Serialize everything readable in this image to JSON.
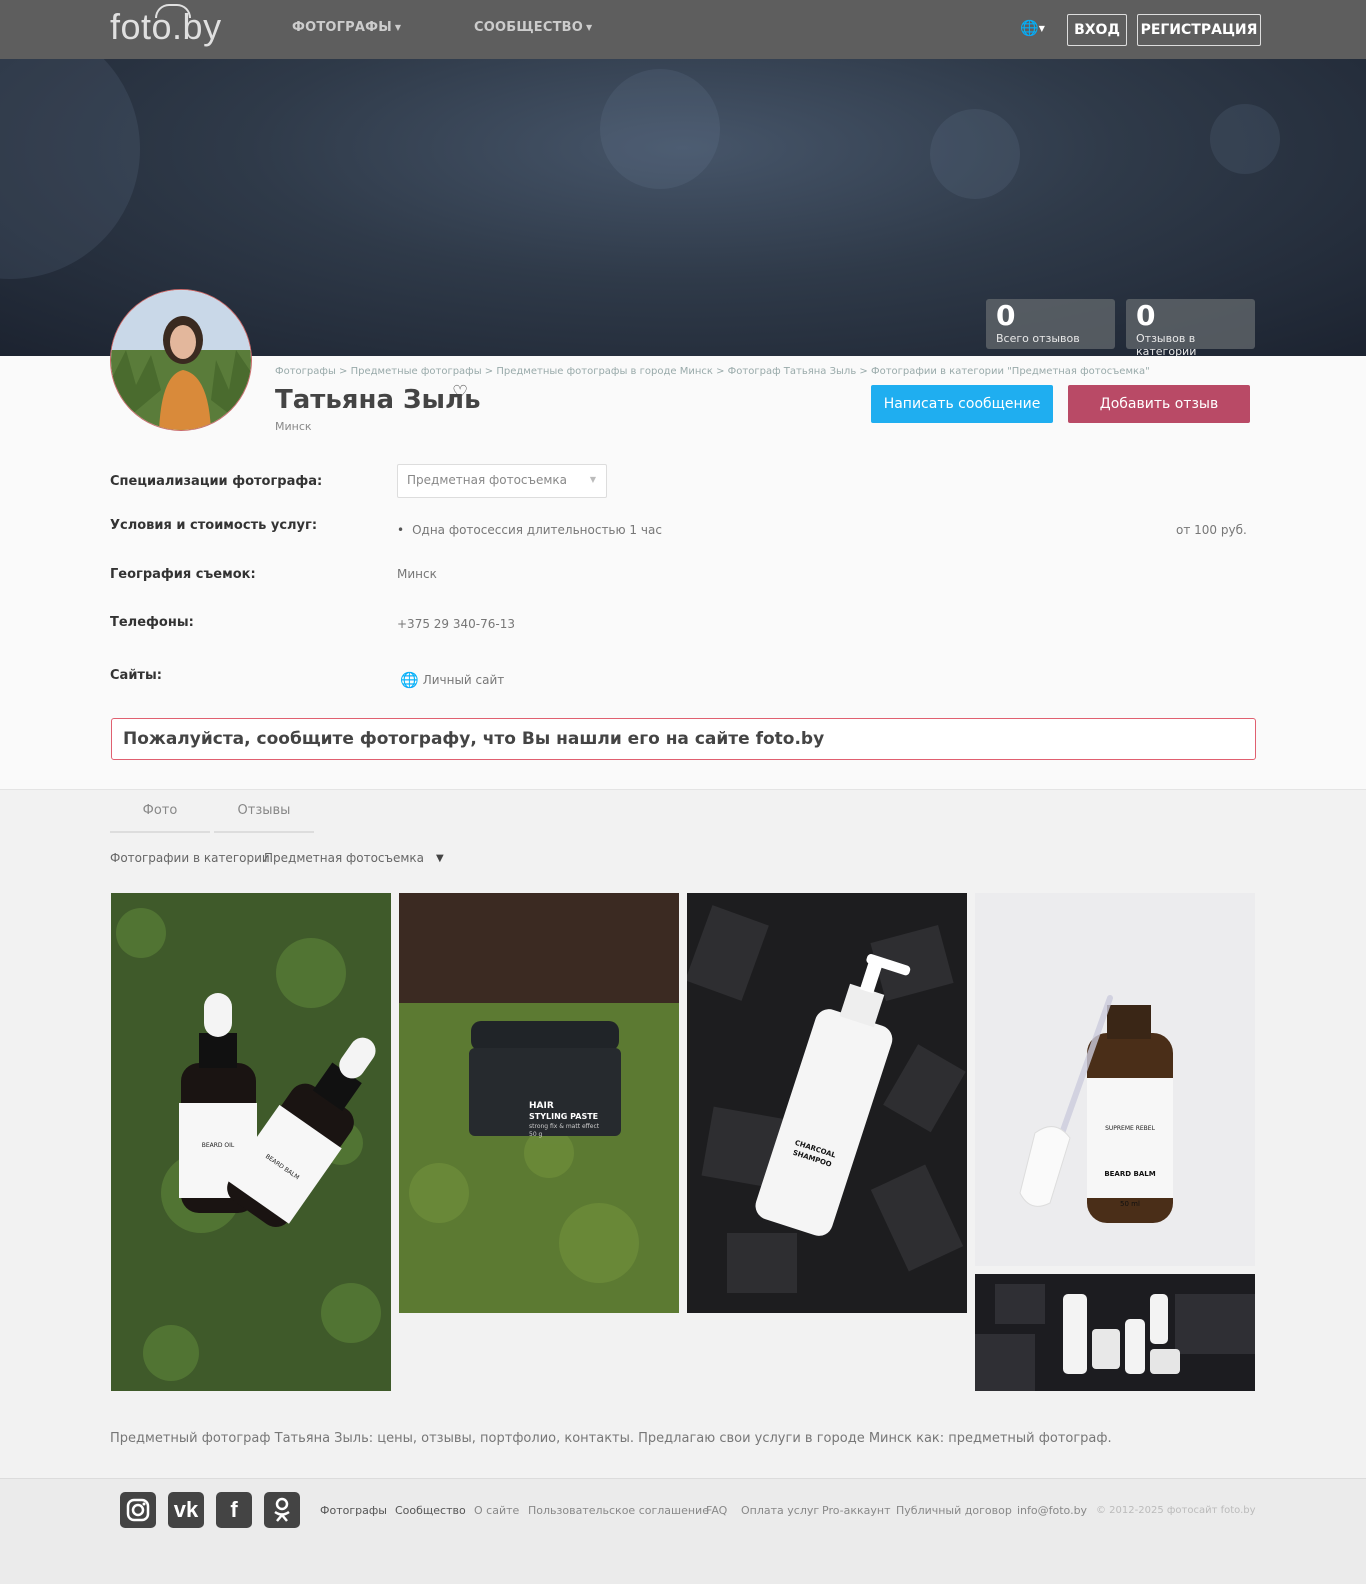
{
  "nav": {
    "logo": "foto.by",
    "photographers": "ФОТОГРАФЫ",
    "community": "СООБЩЕСТВО",
    "login": "ВХОД",
    "register": "РЕГИСТРАЦИЯ"
  },
  "stats": [
    {
      "num": "0",
      "label": "Всего отзывов"
    },
    {
      "num": "0",
      "label": "Отзывов в категории"
    }
  ],
  "breadcrumb": [
    "Фотографы",
    "Предметные фотографы",
    "Предметные фотографы в городе Минск",
    "Фотограф Татьяна Зыль",
    "Фотографии в категории \"Предметная фотосъемка\""
  ],
  "profile": {
    "name": "Татьяна Зыль",
    "city": "Минск",
    "write_message": "Написать сообщение",
    "add_review": "Добавить отзыв"
  },
  "details": {
    "spec_label": "Специализации фотографа:",
    "spec_value": "Предметная фотосъемка",
    "terms_label": "Условия и стоимость услуг:",
    "terms_item": "Одна фотосессия длительностью 1 час",
    "terms_price": "от 100 руб.",
    "geo_label": "География съемок:",
    "geo_value": "Минск",
    "phones_label": "Телефоны:",
    "phones_value": "+375 29 340-76-13",
    "sites_label": "Сайты:",
    "sites_value": "Личный сайт"
  },
  "notice": "Пожалуйста, сообщите фотографу, что Вы нашли его на сайте foto.by",
  "tabs": [
    "Фото",
    "Отзывы"
  ],
  "filter": {
    "label": "Фотографии в категории",
    "value": "Предметная фотосъемка"
  },
  "photos": {
    "p1": {
      "title": "BEARD OIL",
      "sub": "BEARD BALM"
    },
    "p2": {
      "line1": "HAIR",
      "line2": "STYLING PASTE",
      "line3": "strong fix & matt effect",
      "line4": "50 g"
    },
    "p3": {
      "line1": "CHARCOAL",
      "line2": "SHAMPOO"
    },
    "p4": {
      "line1": "SUPREME REBEL",
      "line2": "BEARD BALM",
      "line3": "50 ml"
    }
  },
  "description": "Предметный фотограф Татьяна Зыль: цены, отзывы, портфолио, контакты. Предлагаю свои услуги в городе Минск как: предметный фотограф.",
  "footer": {
    "links": [
      "Фотографы",
      "Сообщество",
      "О сайте",
      "Пользовательское соглашение",
      "FAQ",
      "Оплата услуг",
      "Pro-аккаунт",
      "Публичный договор",
      "info@foto.by"
    ],
    "copyright": "© 2012-2025 фотосайт foto.by"
  },
  "icons": {
    "instagram": "instagram-icon",
    "vk": "vk-icon",
    "facebook": "facebook-icon",
    "ok": "odnoklassniki-icon",
    "globe": "globe-icon",
    "heart": "heart-icon"
  },
  "colors": {
    "accent_blue": "#1faef0",
    "accent_red": "#b94a66",
    "nav_bg": "#5e5e5e"
  }
}
